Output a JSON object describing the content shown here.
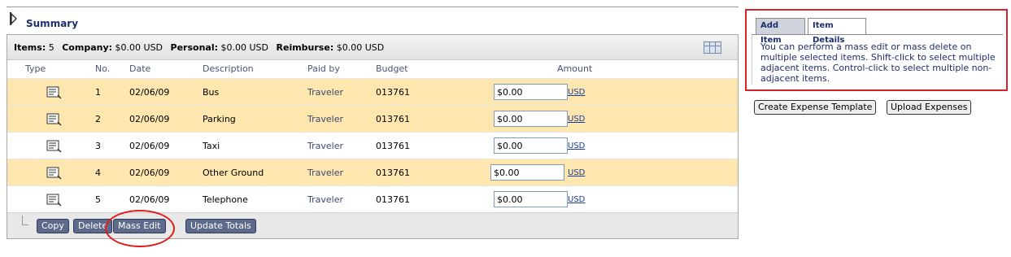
{
  "summary": {
    "title": "Summary",
    "totals": {
      "items_label": "Items:",
      "items_value": "5",
      "company_label": "Company:",
      "company_value": "$0.00 USD",
      "personal_label": "Personal:",
      "personal_value": "$0.00 USD",
      "reimburse_label": "Reimburse:",
      "reimburse_value": "$0.00 USD"
    },
    "columns": [
      "Type",
      "No.",
      "Date",
      "Description",
      "Paid by",
      "Budget",
      "Amount"
    ],
    "rows": [
      {
        "no": "1",
        "date": "02/06/09",
        "description": "Bus",
        "paid_by": "Traveler",
        "budget": "013761",
        "amount": "$0.00",
        "currency": "USD",
        "highlighted": true
      },
      {
        "no": "2",
        "date": "02/06/09",
        "description": "Parking",
        "paid_by": "Traveler",
        "budget": "013761",
        "amount": "$0.00",
        "currency": "USD",
        "highlighted": true
      },
      {
        "no": "3",
        "date": "02/06/09",
        "description": "Taxi",
        "paid_by": "Traveler",
        "budget": "013761",
        "amount": "$0.00",
        "currency": "USD",
        "highlighted": false
      },
      {
        "no": "4",
        "date": "02/06/09",
        "description": "Other Ground",
        "paid_by": "Traveler",
        "budget": "013761",
        "amount": "$0.00",
        "currency": "USD",
        "highlighted": true
      },
      {
        "no": "5",
        "date": "02/06/09",
        "description": "Telephone",
        "paid_by": "Traveler",
        "budget": "013761",
        "amount": "$0.00",
        "currency": "USD",
        "highlighted": false
      }
    ],
    "buttons": {
      "copy": "Copy",
      "delete": "Delete",
      "mass_edit": "Mass Edit",
      "update_totals": "Update Totals"
    }
  },
  "help_panel": {
    "tabs": [
      "Add Item",
      "Item Details"
    ],
    "active_tab": "Item Details",
    "text": "You can perform a mass edit or mass delete on multiple selected items. Shift-click to select multiple adjacent items. Control-click to select multiple non-adjacent items."
  },
  "actions": {
    "create_template": "Create Expense Template",
    "upload_expenses": "Upload Expenses"
  },
  "colors": {
    "highlight_row": "#fde7ae",
    "title_blue": "#1e2d6e",
    "callout_red": "#e31a1a",
    "dark_button": "#5d6a8c"
  },
  "icons": {
    "collapse_toggle": "triangle-right-icon",
    "column_chooser": "grid-icon",
    "expense_type": "expense-document-icon"
  }
}
